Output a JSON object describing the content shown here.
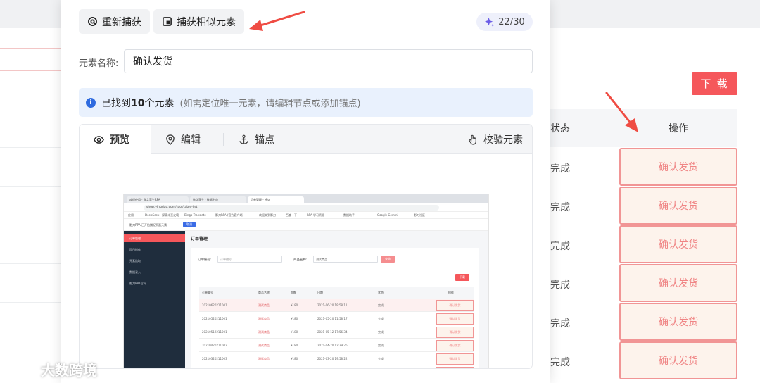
{
  "modal": {
    "recapture_label": "重新捕获",
    "capture_similar_label": "捕获相似元素",
    "counter": "22/30",
    "name_label": "元素名称:",
    "name_value": "确认发货",
    "info_prefix": "已找到",
    "info_count": "10",
    "info_suffix": "个元素",
    "info_hint": "(如需定位唯一元素，请编辑节点或添加锚点)",
    "tabs": [
      {
        "label": "预览",
        "icon": "eye-icon"
      },
      {
        "label": "编辑",
        "icon": "location-pin-icon"
      },
      {
        "label": "锚点",
        "icon": "anchor-icon"
      }
    ],
    "verify_label": "校验元素"
  },
  "mini_browser": {
    "tabs": [
      "欢迎使用 · 数字孪生RPA",
      "数字孪生 · 数据中心",
      "订单管理 - Mio"
    ],
    "url": "shop.yingdao.com/tool/table-list",
    "bookmarks": [
      "应用",
      "DeepSeek · 探索未至之境",
      "Bingo Translate",
      "影刀RPA (官方客户端)",
      "欢迎来到影刀",
      "百度一下",
      "RPA 学习资源",
      "数据助手",
      "Google Gemini",
      "影刀社区"
    ],
    "extension_text": "影刀RPA 已开始捕捉页面元素",
    "extension_btn": "取消",
    "sidebar": [
      "订单管理",
      "项目操作",
      "元素选取",
      "数据录入",
      "影刀RPA官网"
    ],
    "page_title": "订单管理",
    "filter_order_label": "订单编号:",
    "filter_order_placeholder": "订单编号",
    "filter_product_label": "商品名称:",
    "filter_product_value": "测试商品",
    "search_label": "查询",
    "download_label": "下载",
    "columns": [
      "订单编号",
      "商品名称",
      "金额",
      "日期",
      "状态",
      "操作"
    ],
    "rows": [
      [
        "20210620211001",
        "测试商品",
        "¥180",
        "2021-06-20 19:58:11",
        "完成",
        "确认发货"
      ],
      [
        "20210520211001",
        "测试商品",
        "¥180",
        "2021-05-20 11:58:17",
        "完成",
        "确认发货"
      ],
      [
        "20210512211001",
        "测试商品",
        "¥180",
        "2021-05-12 17:56:34",
        "完成",
        "确认发货"
      ],
      [
        "20210420211002",
        "测试商品",
        "¥180",
        "2021-04-20 12:39:26",
        "完成",
        "确认发货"
      ],
      [
        "20210320211003",
        "测试商品",
        "¥180",
        "2021-03-20 19:58:22",
        "完成",
        "确认发货"
      ],
      [
        "20210314211002",
        "测试商品",
        "¥180",
        "2021-03-14 17:56:34",
        "待发",
        "确认发货"
      ],
      [
        "20210120211012",
        "测试商品",
        "¥180",
        "2021-01-20 13:41:24",
        "完成",
        "确认发货"
      ]
    ]
  },
  "background": {
    "download_label": "下 载",
    "col_status": "状态",
    "col_op": "操作",
    "status_values": [
      "完成",
      "完成",
      "完成",
      "完成",
      "完成",
      "完成"
    ],
    "confirm_label": "确认发货"
  },
  "watermark": "大数跨境",
  "colors": {
    "accent_red": "#f5575b",
    "info_blue": "#2f6bdf",
    "confirm_border": "#f19595",
    "confirm_text": "#f08585"
  }
}
